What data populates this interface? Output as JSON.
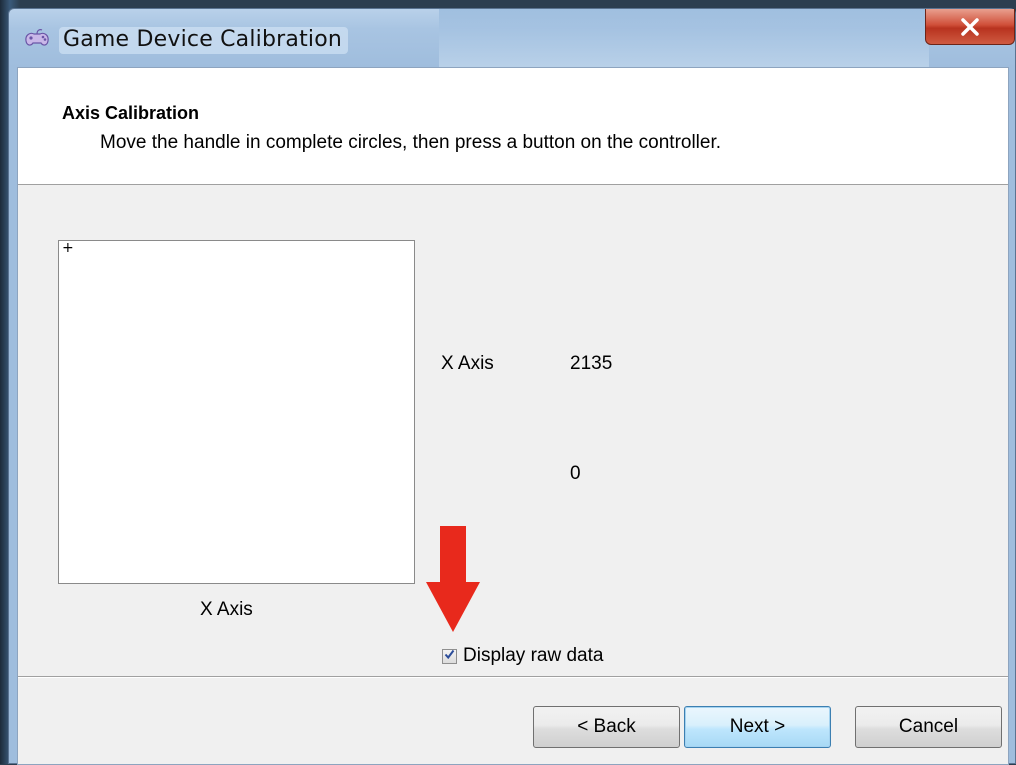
{
  "window": {
    "title": "Game Device Calibration",
    "icons": {
      "app": "gamepad-icon",
      "close": "close-icon"
    }
  },
  "header": {
    "title": "Axis Calibration",
    "subtitle": "Move the handle in complete circles, then press a button on the controller."
  },
  "plot": {
    "crosshair": "+",
    "caption": "X Axis"
  },
  "readout": {
    "axis_label": "X Axis",
    "axis_value": "2135",
    "second_value": "0"
  },
  "annotation": {
    "arrow_color": "#e8291c",
    "arrow_icon": "down-arrow-icon"
  },
  "options": {
    "display_raw_data_label": "Display raw data",
    "display_raw_data_checked": true
  },
  "buttons": {
    "back": "< Back",
    "next": "Next >",
    "cancel": "Cancel"
  }
}
